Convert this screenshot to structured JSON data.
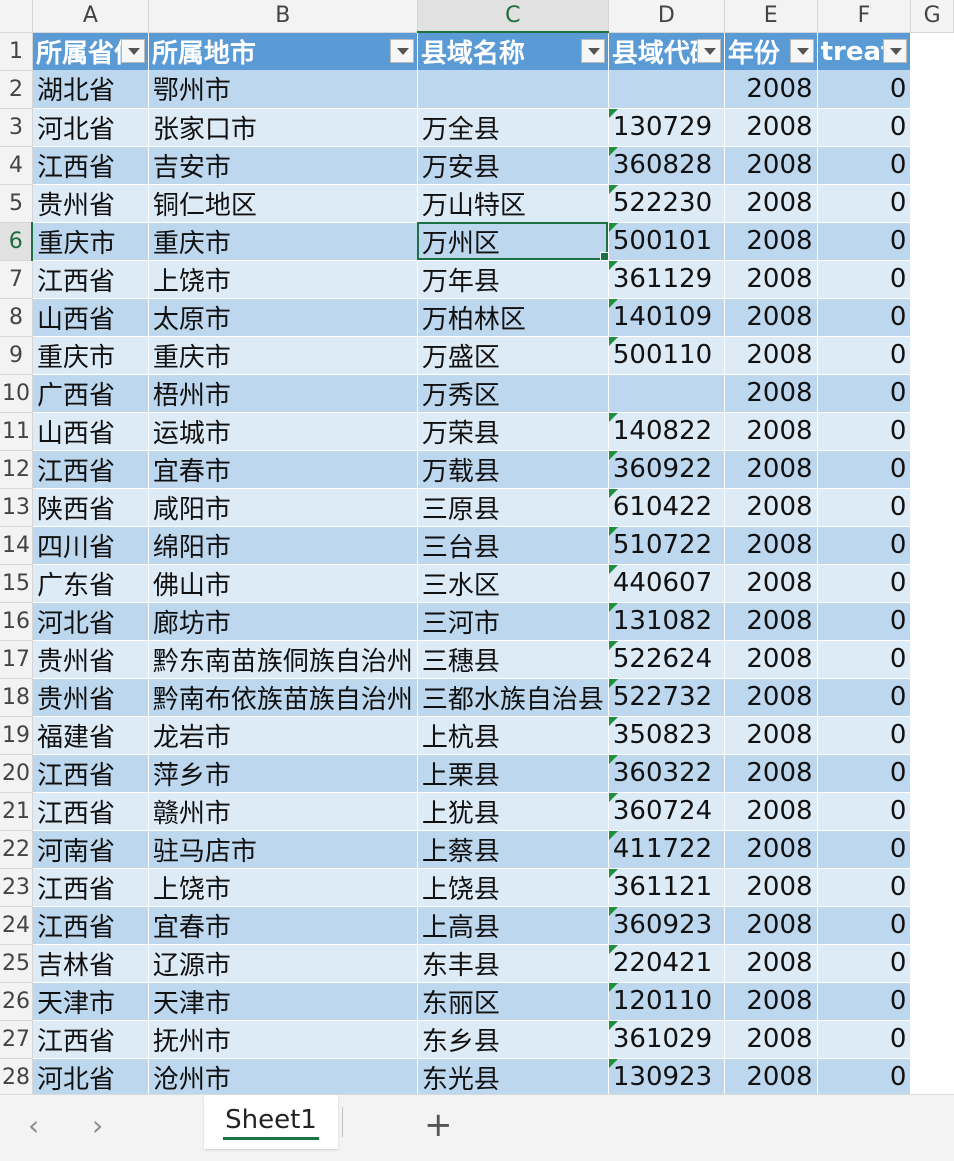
{
  "columns": [
    "A",
    "B",
    "C",
    "D",
    "E",
    "F",
    "G"
  ],
  "header": [
    "所属省份",
    "所属地市",
    "县域名称",
    "县域代码",
    "年份",
    "treat"
  ],
  "rows": [
    [
      "湖北省",
      "鄂州市",
      "",
      "",
      "2008",
      "0"
    ],
    [
      "河北省",
      "张家口市",
      "万全县",
      "130729",
      "2008",
      "0"
    ],
    [
      "江西省",
      "吉安市",
      "万安县",
      "360828",
      "2008",
      "0"
    ],
    [
      "贵州省",
      "铜仁地区",
      "万山特区",
      "522230",
      "2008",
      "0"
    ],
    [
      "重庆市",
      "重庆市",
      "万州区",
      "500101",
      "2008",
      "0"
    ],
    [
      "江西省",
      "上饶市",
      "万年县",
      "361129",
      "2008",
      "0"
    ],
    [
      "山西省",
      "太原市",
      "万柏林区",
      "140109",
      "2008",
      "0"
    ],
    [
      "重庆市",
      "重庆市",
      "万盛区",
      "500110",
      "2008",
      "0"
    ],
    [
      "广西省",
      "梧州市",
      "万秀区",
      "",
      "2008",
      "0"
    ],
    [
      "山西省",
      "运城市",
      "万荣县",
      "140822",
      "2008",
      "0"
    ],
    [
      "江西省",
      "宜春市",
      "万载县",
      "360922",
      "2008",
      "0"
    ],
    [
      "陕西省",
      "咸阳市",
      "三原县",
      "610422",
      "2008",
      "0"
    ],
    [
      "四川省",
      "绵阳市",
      "三台县",
      "510722",
      "2008",
      "0"
    ],
    [
      "广东省",
      "佛山市",
      "三水区",
      "440607",
      "2008",
      "0"
    ],
    [
      "河北省",
      "廊坊市",
      "三河市",
      "131082",
      "2008",
      "0"
    ],
    [
      "贵州省",
      "黔东南苗族侗族自治州",
      "三穗县",
      "522624",
      "2008",
      "0"
    ],
    [
      "贵州省",
      "黔南布依族苗族自治州",
      "三都水族自治县",
      "522732",
      "2008",
      "0"
    ],
    [
      "福建省",
      "龙岩市",
      "上杭县",
      "350823",
      "2008",
      "0"
    ],
    [
      "江西省",
      "萍乡市",
      "上栗县",
      "360322",
      "2008",
      "0"
    ],
    [
      "江西省",
      "赣州市",
      "上犹县",
      "360724",
      "2008",
      "0"
    ],
    [
      "河南省",
      "驻马店市",
      "上蔡县",
      "411722",
      "2008",
      "0"
    ],
    [
      "江西省",
      "上饶市",
      "上饶县",
      "361121",
      "2008",
      "0"
    ],
    [
      "江西省",
      "宜春市",
      "上高县",
      "360923",
      "2008",
      "0"
    ],
    [
      "吉林省",
      "辽源市",
      "东丰县",
      "220421",
      "2008",
      "0"
    ],
    [
      "天津市",
      "天津市",
      "东丽区",
      "120110",
      "2008",
      "0"
    ],
    [
      "江西省",
      "抚州市",
      "东乡县",
      "361029",
      "2008",
      "0"
    ],
    [
      "河北省",
      "沧州市",
      "东光县",
      "130923",
      "2008",
      "0"
    ]
  ],
  "selected": {
    "col": "C",
    "row": 6
  },
  "tabs": {
    "nav_prev": "‹",
    "nav_next": "›",
    "sheet": "Sheet1",
    "add": "+"
  },
  "accent": "#1e7145",
  "header_color": "#5b9bd5",
  "band_dark": "#bdd7ee",
  "band_light": "#ddebf7"
}
